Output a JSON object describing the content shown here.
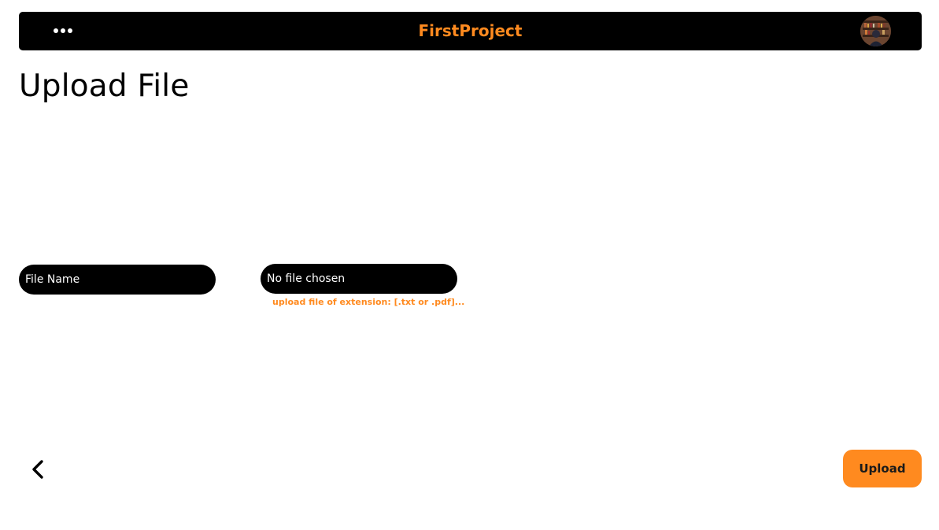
{
  "header": {
    "menu_icon": "more-horizontal-icon",
    "title": "FirstProject",
    "avatar_icon": "user-avatar"
  },
  "main": {
    "title": "Upload File",
    "file_name_field": {
      "placeholder": "File Name",
      "value": ""
    },
    "file_picker": {
      "status": "No file chosen",
      "hint": "upload file of extension: [.txt or .pdf]..."
    }
  },
  "footer": {
    "back_icon": "chevron-left-icon",
    "upload_label": "Upload"
  },
  "colors": {
    "accent": "#ff8a1f",
    "bar": "#000000",
    "background": "#ffffff"
  }
}
